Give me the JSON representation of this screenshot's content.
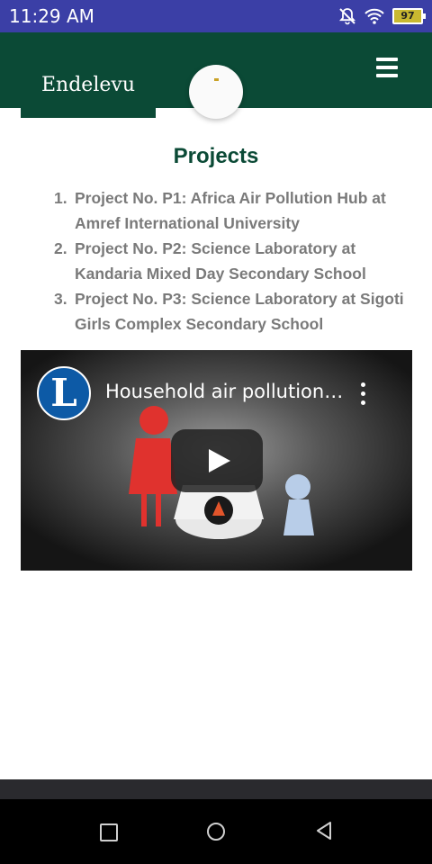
{
  "status_bar": {
    "time": "11:29 AM",
    "battery_level": "97",
    "icons": [
      "notifications-off-icon",
      "wifi-icon",
      "battery-icon"
    ]
  },
  "header": {
    "logo_text": "Endelevu",
    "menu_icon": "hamburger-menu-icon",
    "colors": {
      "primary": "#0b4a36"
    }
  },
  "main": {
    "title": "Projects",
    "projects": [
      {
        "number": "1.",
        "text": "Project No. P1: Africa Air Pollution Hub at Amref International University"
      },
      {
        "number": "2.",
        "text": "Project No. P2: Science Laboratory at Kandaria Mixed Day Secondary School"
      },
      {
        "number": "3.",
        "text": "Project No. P3: Science Laboratory at Sigoti Girls Complex Secondary School"
      }
    ]
  },
  "video": {
    "channel_initial": "L",
    "title": "Household air pollution…",
    "icons": [
      "channel-logo-icon",
      "more-options-icon",
      "play-icon"
    ]
  },
  "nav_bar": {
    "icons": [
      "recent-apps-icon",
      "home-icon",
      "back-icon"
    ]
  }
}
